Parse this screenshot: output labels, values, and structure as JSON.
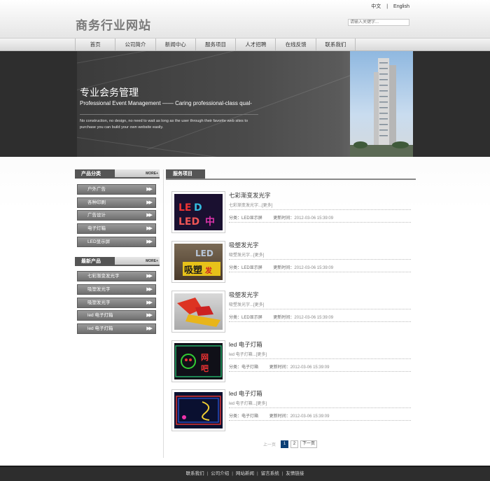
{
  "header": {
    "site_title": "商务行业网站",
    "lang_cn": "中文",
    "lang_sep": "|",
    "lang_en": "English",
    "search_placeholder": "请输入关键字..."
  },
  "nav": {
    "items": [
      "首页",
      "公司简介",
      "新闻中心",
      "服务项目",
      "人才招聘",
      "在线反馈",
      "联系我们"
    ]
  },
  "banner": {
    "title": "专业会务管理",
    "subtitle": "Professional Event Management —— Caring professional-class qual-",
    "desc_line1": "No construction, no design, no need to wait as long as the user through their favorite web sites to",
    "desc_line2": "purchase you can build your own website easily."
  },
  "sidebar": {
    "categories_title": "产品分类",
    "more_label": "MORE+",
    "categories": [
      "户外广告",
      "各种印刷",
      "广告设计",
      "电子灯箱",
      "LED显示屏"
    ],
    "latest_title": "最新产品",
    "latest": [
      "七彩渐变发光字",
      "吸塑发光字",
      "吸塑发光字",
      "led 电子灯箱",
      "led 电子灯箱"
    ],
    "arrow": "▶▶"
  },
  "content": {
    "section_title": "服务项目",
    "category_label": "分类：",
    "time_label": "更新时间：",
    "products": [
      {
        "title": "七彩渐变发光字",
        "desc": "七彩渐变发光字...[更多]",
        "category": "LED显示屏",
        "time": "2012-03-06 15:39:09",
        "thumb_text": "LED中"
      },
      {
        "title": "吸塑发光字",
        "desc": "吸塑发光字...[更多]",
        "category": "LED显示屏",
        "time": "2012-03-06 15:39:09",
        "thumb_text": "吸塑发光"
      },
      {
        "title": "吸塑发光字",
        "desc": "吸塑发光字...[更多]",
        "category": "LED显示屏",
        "time": "2012-03-06 15:39:09",
        "thumb_text": ""
      },
      {
        "title": "led 电子灯箱",
        "desc": "led 电子灯箱...[更多]",
        "category": "电子灯箱",
        "time": "2012-03-06 15:39:09",
        "thumb_text": "网吧"
      },
      {
        "title": "led 电子灯箱",
        "desc": "led 电子灯箱...[更多]",
        "category": "电子灯箱",
        "time": "2012-03-06 15:39:09",
        "thumb_text": ""
      }
    ]
  },
  "pagination": {
    "prev": "上一页",
    "pages": [
      "1",
      "2"
    ],
    "next": "下一页"
  },
  "footer": {
    "links": [
      "联系我们",
      "公司介绍",
      "网站新闻",
      "留言系统",
      "友情链接"
    ]
  }
}
